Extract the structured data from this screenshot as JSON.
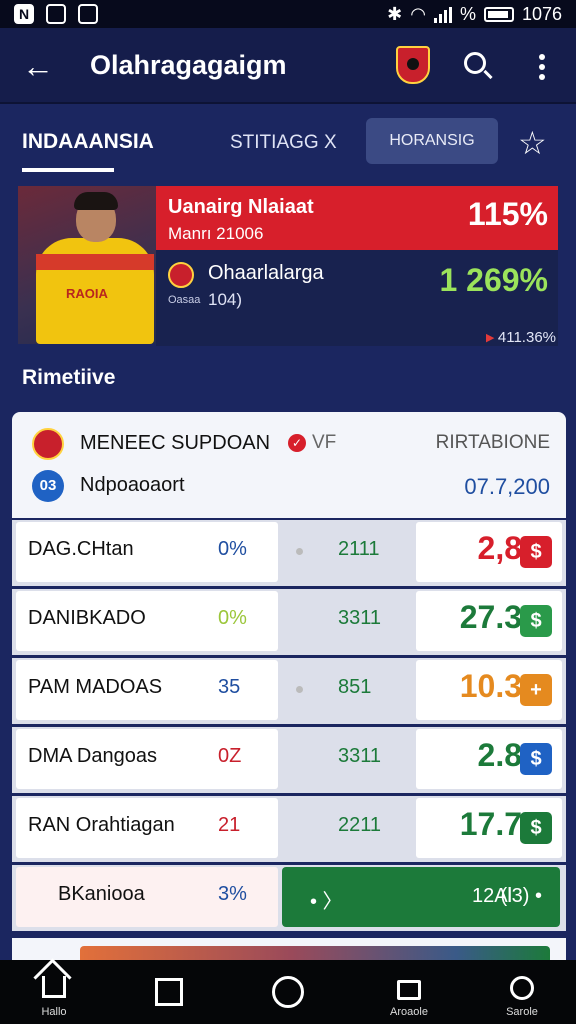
{
  "status_bar": {
    "time": "1076",
    "battery_symbol": "%"
  },
  "app_bar": {
    "back_icon": "arrow-left-icon",
    "title": "Olahragagaigm"
  },
  "tabs": [
    {
      "label": "INDAAANSIA",
      "active": true
    },
    {
      "label": "STITIAGG X",
      "active": false
    },
    {
      "label": "HORANSIG",
      "active": false
    }
  ],
  "featured": {
    "player_name": "Uanairg Nlaiaat",
    "player_sub": "Manrı 21006",
    "player_value": "115%",
    "team_name": "Ohaarlalarga",
    "team_tag": "Oasaa",
    "team_sub": "104)",
    "team_value": "1 269%",
    "footer_value": "411.36%",
    "shirt_text": "RAOIA"
  },
  "section_title": "Rimetiive",
  "match_card": {
    "team": "MENEEC SUPDOAN",
    "vs": "VF",
    "column_label": "RIRTABIONE",
    "badge": "03",
    "subtitle": "Ndpoaoaort",
    "date": "07.7,200"
  },
  "rows": [
    {
      "name": "DAG.CHtan",
      "pct": "0%",
      "mid": "2111",
      "value": "2,8",
      "button": "$",
      "value_color": "#d71f2b",
      "button_color": "#d71f2b",
      "pct_color": "#1f4ea0"
    },
    {
      "name": "DANIBKADO",
      "pct": "0%",
      "mid": "3311",
      "value": "27.3",
      "button": "$",
      "value_color": "#1c7a3a",
      "button_color": "#2a9a4a",
      "pct_color": "#9bc63a"
    },
    {
      "name": "PAM MADOAS",
      "pct": "35",
      "mid": "851",
      "value": "10.3",
      "button": "+",
      "value_color": "#e58a1f",
      "button_color": "#e58a1f",
      "pct_color": "#1f4ea0"
    },
    {
      "name": "DMA Dangoas",
      "pct": "0Z",
      "mid": "3311",
      "value": "2.8",
      "button": "$",
      "value_color": "#1c7a3a",
      "button_color": "#1f62c4",
      "pct_color": "#c8202c"
    },
    {
      "name": "RAN Orahtiagan",
      "pct": "21",
      "mid": "2211",
      "value": "17.7",
      "button": "$",
      "value_color": "#1c7a3a",
      "button_color": "#1c7a3a",
      "pct_color": "#c8202c"
    }
  ],
  "highlight_row": {
    "name": "BKaniooa",
    "pct": "3%",
    "bar_left": "• 〉",
    "bar_mid": "12Al",
    "bar_right": "(l3)  •"
  },
  "bottom_nav": [
    {
      "icon": "home-icon",
      "label": "Hallo"
    },
    {
      "icon": "square-icon",
      "label": ""
    },
    {
      "icon": "circle-icon",
      "label": ""
    },
    {
      "icon": "bag-icon",
      "label": "Aroaole"
    },
    {
      "icon": "ring-icon",
      "label": "Sarole"
    }
  ]
}
